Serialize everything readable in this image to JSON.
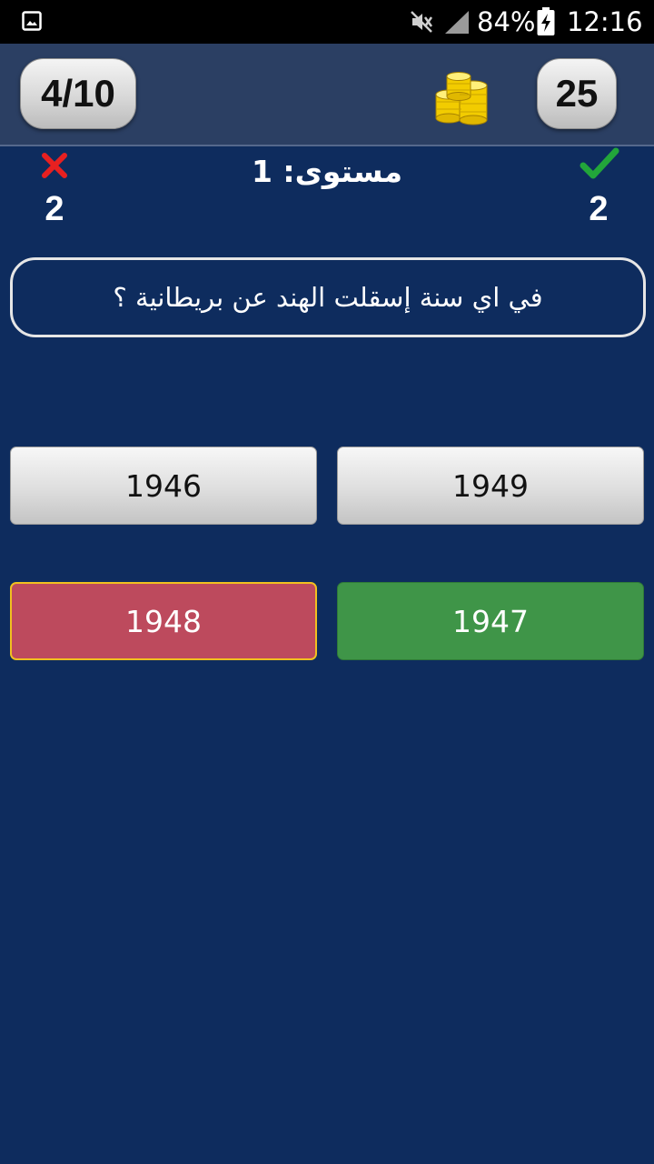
{
  "status_bar": {
    "battery_percent": "84%",
    "time": "12:16",
    "icons": [
      "gallery-icon",
      "mute-icon",
      "signal-icon",
      "battery-charging-icon"
    ]
  },
  "header": {
    "progress": "4/10",
    "coins": "25",
    "coins_icon": "gold-coins-icon"
  },
  "score": {
    "wrong_count": "2",
    "correct_count": "2",
    "wrong_color": "#e82020",
    "correct_color": "#22a63a"
  },
  "level": {
    "label": "مستوى: 1"
  },
  "question": {
    "text": "في اي سنة إسقلت الهند عن بريطانية ؟"
  },
  "answers": [
    {
      "label": "1949",
      "state": "default"
    },
    {
      "label": "1946",
      "state": "default"
    },
    {
      "label": "1947",
      "state": "correct"
    },
    {
      "label": "1948",
      "state": "wrong"
    }
  ],
  "colors": {
    "background": "#0e2c5e",
    "top_bar": "#2b3f63",
    "correct_answer": "#3f9548",
    "wrong_answer": "#bd4a5d",
    "wrong_answer_border": "#f0c020"
  }
}
